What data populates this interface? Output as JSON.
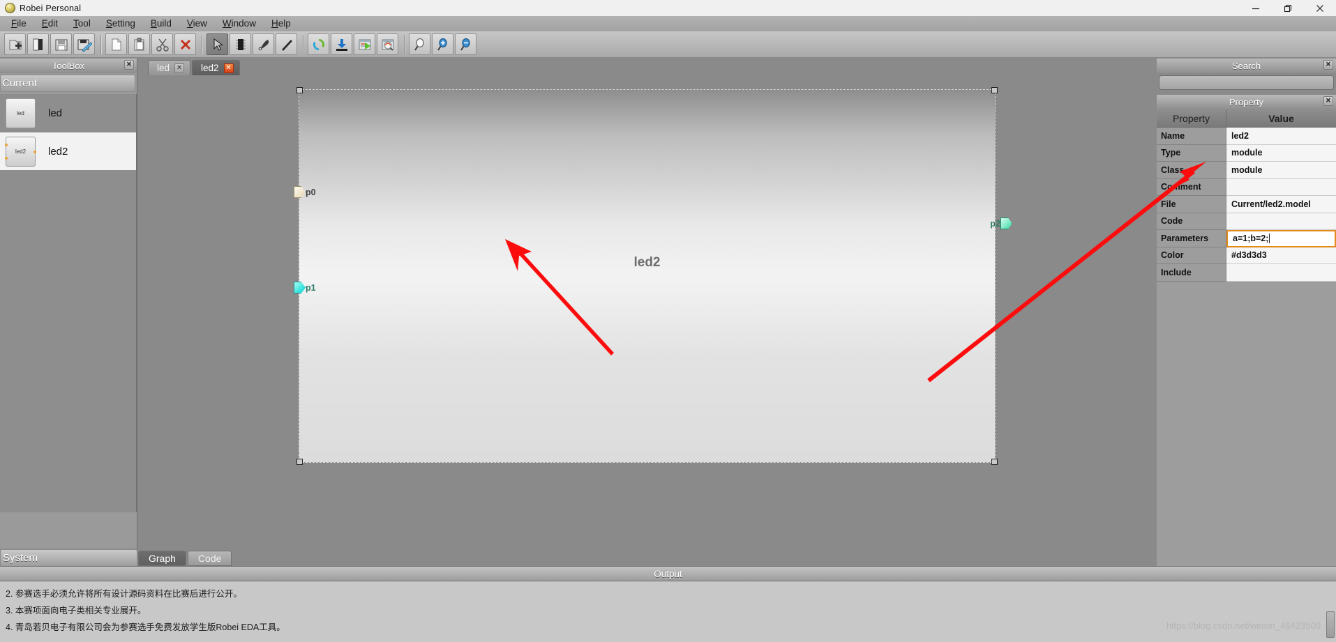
{
  "window": {
    "title": "Robei  Personal",
    "logo_icon": "robei-logo-icon",
    "minimize_icon": "minimize-icon",
    "restore_icon": "restore-icon",
    "close_icon": "close-icon"
  },
  "menubar": {
    "items": [
      {
        "label": "File",
        "accel": "F"
      },
      {
        "label": "Edit",
        "accel": "E"
      },
      {
        "label": "Tool",
        "accel": "T"
      },
      {
        "label": "Setting",
        "accel": "S"
      },
      {
        "label": "Build",
        "accel": "B"
      },
      {
        "label": "View",
        "accel": "V"
      },
      {
        "label": "Window",
        "accel": "W"
      },
      {
        "label": "Help",
        "accel": "H"
      }
    ]
  },
  "toolbar": {
    "groups": [
      [
        "new-project-icon",
        "open-project-icon",
        "save-icon",
        "save-as-icon"
      ],
      [
        "new-file-icon",
        "paste-icon",
        "cut-icon",
        "delete-icon"
      ],
      [
        "select-pointer-icon",
        "module-chip-icon",
        "port-icon",
        "wire-line-icon"
      ],
      [
        "refresh-icon",
        "download-icon",
        "compile-run-icon",
        "simulate-icon"
      ],
      [
        "zoom-icon",
        "zoom-in-icon",
        "zoom-out-icon"
      ]
    ]
  },
  "toolbox": {
    "title": "ToolBox",
    "close_icon": "close-icon",
    "current_label": "Current",
    "items": [
      {
        "label": "led",
        "thumb_text": "led",
        "selected": false,
        "pins": 0
      },
      {
        "label": "led2",
        "thumb_text": "led2",
        "selected": true,
        "pins": 3
      }
    ],
    "system_label": "System"
  },
  "editor": {
    "tabs": [
      {
        "label": "led",
        "active": false,
        "close_icon": "close-icon"
      },
      {
        "label": "led2",
        "active": true,
        "close_icon": "close-icon"
      }
    ],
    "module": {
      "name": "led2",
      "color": "#d3d3d3",
      "ports": [
        {
          "name": "p0",
          "side": "left",
          "color": "#f5ecd8",
          "type": "input"
        },
        {
          "name": "p1",
          "side": "left",
          "color": "#1ee0e0",
          "type": "inout"
        },
        {
          "name": "p2",
          "side": "right",
          "color": "#57e3b2",
          "type": "output"
        }
      ]
    },
    "view_tabs": [
      {
        "label": "Graph",
        "active": true
      },
      {
        "label": "Code",
        "active": false
      }
    ]
  },
  "search": {
    "title": "Search",
    "close_icon": "close-icon",
    "value": "",
    "placeholder": ""
  },
  "property": {
    "title": "Property",
    "close_icon": "close-icon",
    "columns": [
      "Property",
      "Value"
    ],
    "rows": [
      {
        "key": "Name",
        "value": "led2",
        "editing": false
      },
      {
        "key": "Type",
        "value": "module",
        "editing": false
      },
      {
        "key": "Class",
        "value": "module",
        "editing": false
      },
      {
        "key": "Comment",
        "value": "",
        "editing": false
      },
      {
        "key": "File",
        "value": "Current/led2.model",
        "editing": false
      },
      {
        "key": "Code",
        "value": "",
        "editing": false
      },
      {
        "key": "Parameters",
        "value": "a=1;b=2;",
        "editing": true
      },
      {
        "key": "Color",
        "value": "#d3d3d3",
        "editing": false
      },
      {
        "key": "Include",
        "value": "",
        "editing": false
      }
    ],
    "highlight_color": "#e38b1b"
  },
  "output": {
    "title": "Output",
    "lines": [
      "2. 参赛选手必须允许将所有设计源码资料在比赛后进行公开。",
      "3. 本赛项面向电子类相关专业展开。",
      "4. 青岛若贝电子有限公司会为参赛选手免费发放学生版Robei EDA工具。"
    ]
  },
  "watermark": {
    "text": "https://blog.csdn.net/weixin_46423500"
  },
  "annotations": {
    "arrow_color": "#fb0d0d",
    "arrows": [
      "canvas-annotation-arrow",
      "parameters-annotation-arrow"
    ]
  }
}
